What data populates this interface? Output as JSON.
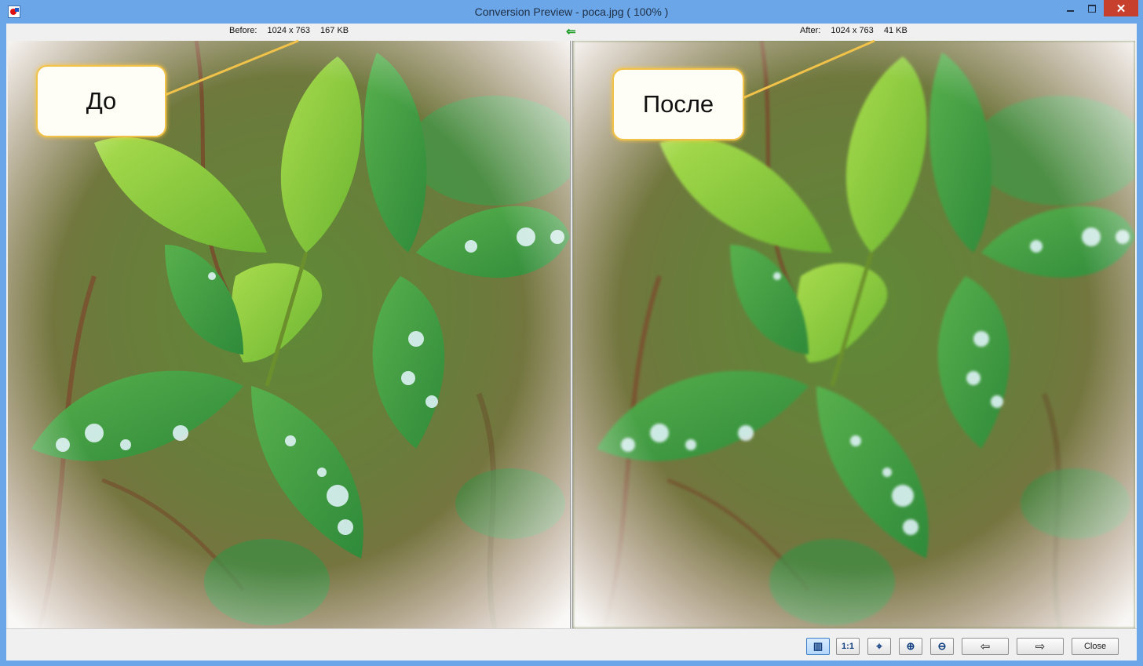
{
  "window": {
    "title": "Conversion Preview - poca.jpg  ( 100% )",
    "close_glyph": "✕"
  },
  "before": {
    "label": "Before:",
    "dimensions": "1024 x 763",
    "size": "167 KB",
    "callout": "До"
  },
  "after": {
    "label": "After:",
    "dimensions": "1024 x 763",
    "size": "41 KB",
    "callout": "После"
  },
  "sync_arrow_glyph": "⇐",
  "toolbar": {
    "split_view_glyph": "▥",
    "actual_size_label": "1:1",
    "fit_glyph": "⌖",
    "zoom_in_glyph": "⊕",
    "zoom_out_glyph": "⊖",
    "prev_glyph": "⇦",
    "next_glyph": "⇨",
    "close_label": "Close"
  },
  "colors": {
    "titlebar": "#6aa6e8",
    "callout_border": "#f1c24a",
    "leaf_light": "#8fce3c",
    "leaf_dark": "#3f9a3a"
  }
}
